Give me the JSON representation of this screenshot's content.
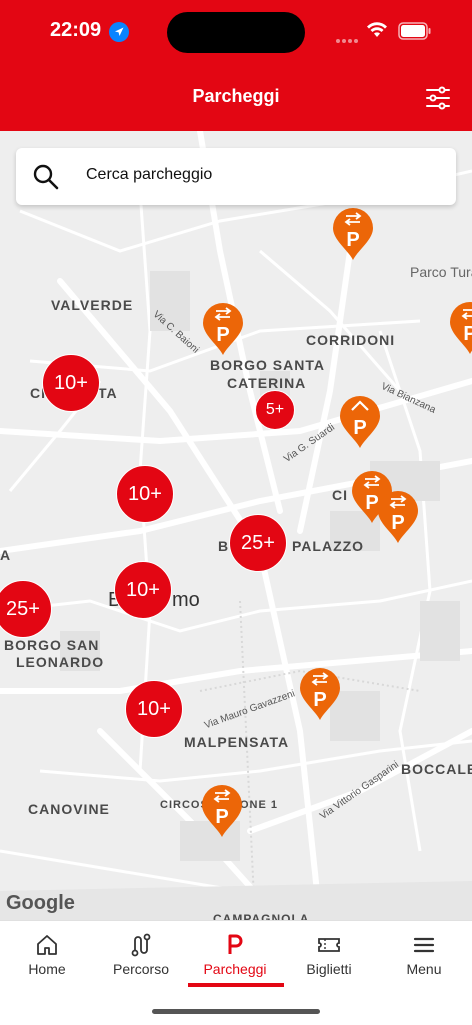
{
  "status_bar": {
    "time": "22:09"
  },
  "header": {
    "title": "Parcheggi"
  },
  "search": {
    "placeholder": "Cerca parcheggio"
  },
  "map": {
    "district_labels": [
      "VALVERDE",
      "CORRIDONI",
      "BORGO SANTA",
      "CATERINA",
      "CI",
      "TA",
      "CI",
      "BO",
      "PALAZZO",
      "BORGO SAN",
      "LEONARDO",
      "MALPENSATA",
      "BOCCALE",
      "CANOVINE",
      "CIRCOS",
      "ONE 1",
      "CAMPAGNOLA",
      "A"
    ],
    "street_labels": [
      "Via C. Baioni",
      "Via Bianzana",
      "Via G. Suardi",
      "Via Mauro Gavazzeni",
      "Via Vittorio Gasparini"
    ],
    "place_labels": [
      "Parco Tura",
      "B",
      "mo"
    ],
    "clusters": [
      "10+",
      "5+",
      "10+",
      "25+",
      "10+",
      "25+",
      "10+"
    ],
    "pins": [
      "P",
      "P",
      "P",
      "P",
      "P",
      "P",
      "P",
      "P"
    ],
    "attribution": "Google"
  },
  "tabs": [
    {
      "label": "Home",
      "icon": "home-icon"
    },
    {
      "label": "Percorso",
      "icon": "route-icon"
    },
    {
      "label": "Parcheggi",
      "icon": "parking-icon",
      "active": true
    },
    {
      "label": "Biglietti",
      "icon": "ticket-icon"
    },
    {
      "label": "Menu",
      "icon": "menu-icon"
    }
  ],
  "colors": {
    "brand": "#e30613",
    "pin": "#ec6608"
  }
}
